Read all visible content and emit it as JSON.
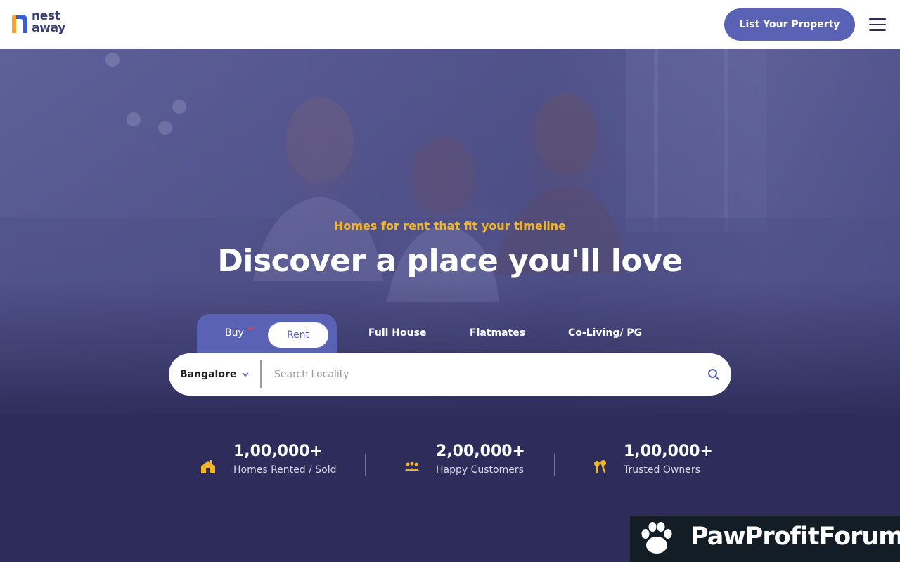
{
  "header": {
    "logo_line1": "nest",
    "logo_line2": "away",
    "list_property_label": "List Your Property",
    "menu_icon": "hamburger-menu-icon"
  },
  "hero": {
    "tagline": "Homes for rent that fit your timeline",
    "headline": "Discover a place you'll love"
  },
  "tabs": {
    "buy_label": "Buy",
    "rent_label": "Rent",
    "active_mode": "Rent",
    "categories": [
      "Full House",
      "Flatmates",
      "Co-Living/ PG"
    ]
  },
  "search": {
    "city": "Bangalore",
    "placeholder": "Search Locality",
    "value": "",
    "icon": "search-icon"
  },
  "stats": [
    {
      "value": "1,00,000+",
      "label": "Homes Rented / Sold",
      "icon": "house-icon"
    },
    {
      "value": "2,00,000+",
      "label": "Happy Customers",
      "icon": "people-icon"
    },
    {
      "value": "1,00,000+",
      "label": "Trusted Owners",
      "icon": "keys-icon"
    }
  ],
  "watermark": {
    "text": "PawProfitForum"
  },
  "colors": {
    "brand_blue": "#5a62b6",
    "accent_yellow": "#f5b625",
    "hero_dark": "#2e2c5a",
    "logo_orange": "#f5a623"
  }
}
